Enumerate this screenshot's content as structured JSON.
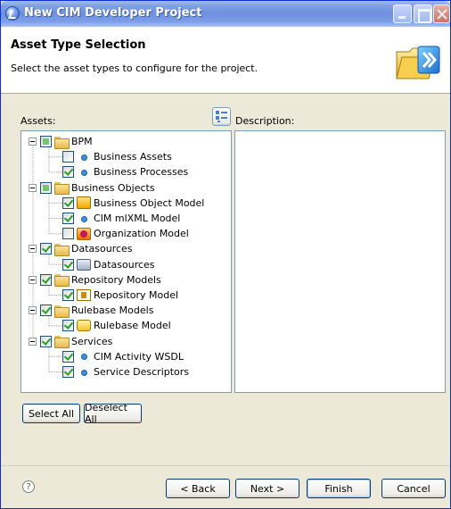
{
  "window": {
    "title": "New CIM Developer Project"
  },
  "banner": {
    "title": "Asset Type Selection",
    "description": "Select the asset types to configure for the project."
  },
  "assets_label": "Assets:",
  "description_label": "Description:",
  "tree": [
    {
      "label": "BPM",
      "state": "partial",
      "icon": "folder-icon",
      "children": [
        {
          "label": "Business Assets",
          "state": "unchecked",
          "icon": "bullet-icon"
        },
        {
          "label": "Business Processes",
          "state": "checked",
          "icon": "bullet-icon"
        }
      ]
    },
    {
      "label": "Business Objects",
      "state": "partial",
      "icon": "folder-icon",
      "children": [
        {
          "label": "Business Object Model",
          "state": "checked",
          "icon": "business-object-model-icon"
        },
        {
          "label": "CIM mlXML Model",
          "state": "checked",
          "icon": "bullet-icon"
        },
        {
          "label": "Organization Model",
          "state": "unchecked",
          "icon": "organization-model-icon"
        }
      ]
    },
    {
      "label": "Datasources",
      "state": "checked",
      "icon": "folder-icon",
      "children": [
        {
          "label": "Datasources",
          "state": "checked",
          "icon": "datasource-icon"
        }
      ]
    },
    {
      "label": "Repository Models",
      "state": "checked",
      "icon": "folder-icon",
      "children": [
        {
          "label": "Repository Model",
          "state": "checked",
          "icon": "repository-model-icon"
        }
      ]
    },
    {
      "label": "Rulebase Models",
      "state": "checked",
      "icon": "folder-icon",
      "children": [
        {
          "label": "Rulebase Model",
          "state": "checked",
          "icon": "rulebase-model-icon"
        }
      ]
    },
    {
      "label": "Services",
      "state": "checked",
      "icon": "folder-icon",
      "children": [
        {
          "label": "CIM Activity WSDL",
          "state": "checked",
          "icon": "bullet-icon"
        },
        {
          "label": "Service Descriptors",
          "state": "checked",
          "icon": "bullet-icon"
        }
      ]
    }
  ],
  "buttons": {
    "select_all": "Select All",
    "deselect_all": "Deselect All",
    "back": "< Back",
    "next": "Next >",
    "finish": "Finish",
    "cancel": "Cancel"
  },
  "help_glyph": "?",
  "colors": {
    "title_bar": "#7f9fe4",
    "dialog_bg": "#ece9d8",
    "check_green": "#21a121",
    "list_border": "#7f9db9"
  }
}
